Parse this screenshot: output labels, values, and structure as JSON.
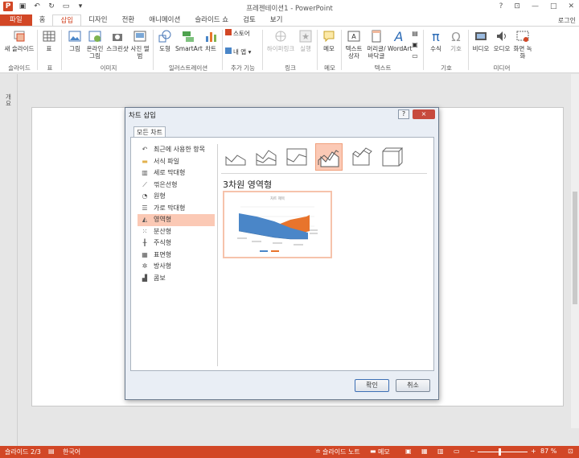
{
  "window": {
    "title": "프레젠테이션1 - PowerPoint",
    "signin": "로그인"
  },
  "tabs": [
    "파일",
    "홈",
    "삽입",
    "디자인",
    "전환",
    "애니메이션",
    "슬라이드 쇼",
    "검토",
    "보기"
  ],
  "active_tab": "삽입",
  "ribbon": {
    "new_slide": "새 슬라이드",
    "table": "표",
    "picture": "그림",
    "online_picture": "온라인 그림",
    "screenshot": "스크린샷",
    "photo_album": "사진 앨범",
    "shapes": "도형",
    "smartart": "SmartArt",
    "chart": "차트",
    "store": "스토어",
    "my_apps": "내 앱",
    "hyperlink": "하이퍼링크",
    "action": "실행",
    "comment": "메모",
    "textbox": "텍스트 상자",
    "header_footer": "머리글/바닥글",
    "wordart": "WordArt",
    "equation": "수식",
    "symbol": "기호",
    "video": "비디오",
    "audio": "오디오",
    "screen_recording": "화면 녹화",
    "groups": {
      "slides": "슬라이드",
      "tables": "표",
      "images": "이미지",
      "illustrations": "일러스트레이션",
      "addins": "추가 기능",
      "links": "링크",
      "comments": "메모",
      "text": "텍스트",
      "symbols": "기호",
      "media": "미디어"
    }
  },
  "left_panel_label": "개요",
  "dialog": {
    "title": "차트 삽입",
    "help": "?",
    "close": "×",
    "tab": "모든 차트",
    "chart_types": [
      {
        "icon": "recent-icon",
        "glyph": "↶",
        "label": "최근에 사용한 항목"
      },
      {
        "icon": "folder-icon",
        "glyph": "▬",
        "label": "서식 파일"
      },
      {
        "icon": "column-chart-icon",
        "glyph": "▥",
        "label": "세로 막대형"
      },
      {
        "icon": "line-chart-icon",
        "glyph": "⟋",
        "label": "꺾은선형"
      },
      {
        "icon": "pie-chart-icon",
        "glyph": "◔",
        "label": "원형"
      },
      {
        "icon": "bar-chart-icon",
        "glyph": "☰",
        "label": "가로 막대형"
      },
      {
        "icon": "area-chart-icon",
        "glyph": "◭",
        "label": "영역형"
      },
      {
        "icon": "scatter-chart-icon",
        "glyph": "⁙",
        "label": "분산형"
      },
      {
        "icon": "stock-chart-icon",
        "glyph": "╫",
        "label": "주식형"
      },
      {
        "icon": "surface-chart-icon",
        "glyph": "▦",
        "label": "표면형"
      },
      {
        "icon": "radar-chart-icon",
        "glyph": "✲",
        "label": "방사형"
      },
      {
        "icon": "combo-chart-icon",
        "glyph": "▟",
        "label": "콤보"
      }
    ],
    "selected_type": "영역형",
    "preview_title": "3차원 영역형",
    "preview_chart_title": "차트 제목",
    "ok": "확인",
    "cancel": "취소"
  },
  "status": {
    "slide": "슬라이드 2/3",
    "lang": "한국어",
    "notes": "슬라이드 노트",
    "comments": "메모",
    "zoom": "87 %"
  },
  "colors": {
    "accent": "#d24726",
    "selection": "#fbc9b5",
    "series1": "#4a86c8",
    "series2": "#e8742c"
  }
}
